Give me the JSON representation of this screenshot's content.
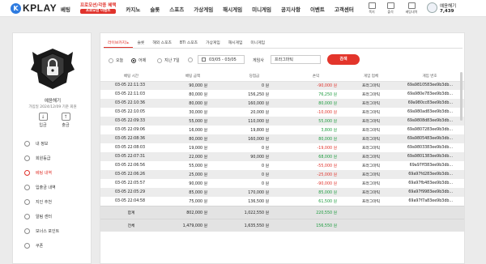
{
  "brand": {
    "logo_mark": "K",
    "logo_text": "KPLAY"
  },
  "nav": {
    "items": [
      "베팅",
      "카지노",
      "슬롯",
      "스포츠",
      "가상게임",
      "해시게임",
      "미니게임",
      "공지사항",
      "이벤트",
      "고객센터"
    ],
    "promo_title": "프로모션/각종 혜택",
    "promo_sub": "프로모션 이벤트"
  },
  "util": {
    "message": "쪽지",
    "coupon": "출석",
    "mypage": "베팅내역"
  },
  "user": {
    "name": "예윤해기",
    "points": "7,439"
  },
  "sidebar": {
    "name": "예윤해기",
    "sub": "가입일 2024/12/09 기준 회원",
    "deposit": "입금",
    "withdraw": "출금",
    "menu": [
      "내 정보",
      "회원등급",
      "베팅 내역",
      "입출금 내역",
      "지인 추천",
      "알림 센터",
      "보너스 포인트",
      "쿠폰"
    ],
    "active_index": 2
  },
  "tabs": [
    "라이브카지노",
    "슬롯",
    "해외 스포츠",
    "BTi 스포츠",
    "가상게임",
    "해시게임",
    "미니게임"
  ],
  "filters": {
    "today": "오늘",
    "yesterday": "어제",
    "last7": "지난 7일",
    "date_range": "03/05 - 03/05",
    "game_label": "게임사",
    "game_value": "프라그마틱",
    "search": "검색"
  },
  "table": {
    "columns": [
      "베팅 시간",
      "베팅 금액",
      "당첨금",
      "손익",
      "게임 업체",
      "게임 번호"
    ],
    "rows": [
      {
        "time": "03-05 22:11:33",
        "bet": "90,000 원",
        "win": "0 원",
        "pl": "-90,000 원",
        "s": "neg",
        "vendor": "프라그마틱",
        "id": "69a9810583ee9b3db..."
      },
      {
        "time": "03-05 22:11:03",
        "bet": "80,000 원",
        "win": "156,250 원",
        "pl": "76,250 원",
        "s": "pos",
        "vendor": "프라그마틱",
        "id": "69a980e783ee9b3db..."
      },
      {
        "time": "03-05 22:10:36",
        "bet": "80,000 원",
        "win": "160,000 원",
        "pl": "80,000 원",
        "s": "pos",
        "vendor": "프라그마틱",
        "id": "69a980cc83ee9b3db..."
      },
      {
        "time": "03-05 22:10:05",
        "bet": "30,000 원",
        "win": "20,000 원",
        "pl": "-10,000 원",
        "s": "neg",
        "vendor": "프라그마틱",
        "id": "69a980ad83ee9b3db..."
      },
      {
        "time": "03-05 22:09:33",
        "bet": "55,000 원",
        "win": "110,000 원",
        "pl": "55,000 원",
        "s": "pos",
        "vendor": "프라그마틱",
        "id": "69a9808d83ee9b3db..."
      },
      {
        "time": "03-05 22:09:06",
        "bet": "16,000 원",
        "win": "19,800 원",
        "pl": "3,800 원",
        "s": "pos",
        "vendor": "프라그마틱",
        "id": "69a9807283ee9b3db..."
      },
      {
        "time": "03-05 22:08:36",
        "bet": "80,000 원",
        "win": "160,000 원",
        "pl": "80,000 원",
        "s": "pos",
        "vendor": "프라그마틱",
        "id": "69a9805483ee9b3db..."
      },
      {
        "time": "03-05 22:08:03",
        "bet": "19,000 원",
        "win": "0 원",
        "pl": "-19,000 원",
        "s": "neg",
        "vendor": "프라그마틱",
        "id": "69a9803383ee9b3db..."
      },
      {
        "time": "03-05 22:07:31",
        "bet": "22,000 원",
        "win": "90,000 원",
        "pl": "68,000 원",
        "s": "pos",
        "vendor": "프라그마틱",
        "id": "69a9801383ee9b3db..."
      },
      {
        "time": "03-05 22:06:56",
        "bet": "55,000 원",
        "win": "0 원",
        "pl": "-55,000 원",
        "s": "neg",
        "vendor": "프라그마틱",
        "id": "69a97ff383ee9b3db..."
      },
      {
        "time": "03-05 22:06:26",
        "bet": "25,000 원",
        "win": "0 원",
        "pl": "-25,000 원",
        "s": "neg",
        "vendor": "프라그마틱",
        "id": "69a97fd283ee9b3db..."
      },
      {
        "time": "03-05 22:05:57",
        "bet": "90,000 원",
        "win": "0 원",
        "pl": "-90,000 원",
        "s": "neg",
        "vendor": "프라그마틱",
        "id": "69a97fb483ee9b3db..."
      },
      {
        "time": "03-05 22:05:29",
        "bet": "85,000 원",
        "win": "170,000 원",
        "pl": "85,000 원",
        "s": "pos",
        "vendor": "프라그마틱",
        "id": "69a97f9983ee9b3db..."
      },
      {
        "time": "03-05 22:04:58",
        "bet": "75,000 원",
        "win": "136,500 원",
        "pl": "61,500 원",
        "s": "pos",
        "vendor": "프라그마틱",
        "id": "69a97f7a83ee9b3db..."
      }
    ],
    "subtotal": {
      "label": "합계",
      "bet": "802,000 원",
      "win": "1,022,550 원",
      "pl": "220,550 원"
    },
    "total": {
      "label": "전체",
      "bet": "1,479,000 원",
      "win": "1,635,550 원",
      "pl": "156,550 원"
    }
  },
  "colors": {
    "accent": "#e0322b",
    "positive": "#1a9a3c",
    "logo": "#2e7be0"
  }
}
